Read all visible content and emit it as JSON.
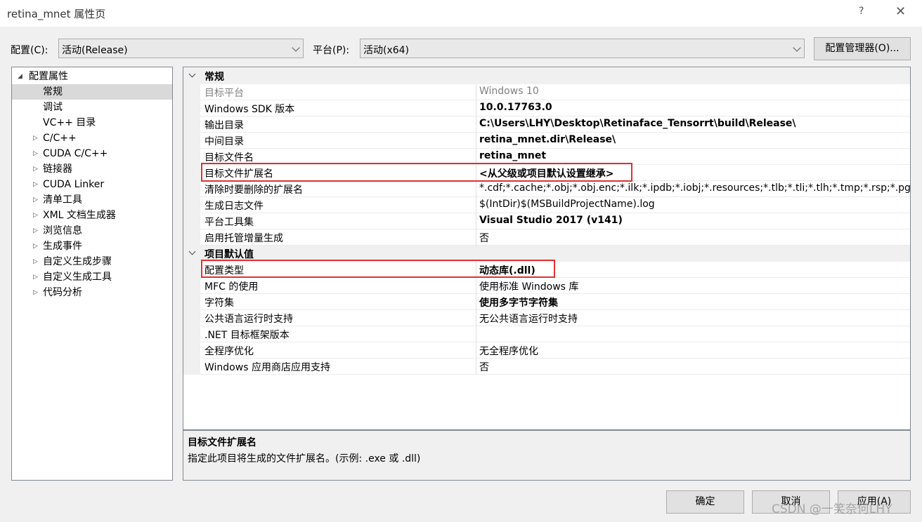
{
  "window": {
    "title": "retina_mnet 属性页",
    "help": "?",
    "close": "✕"
  },
  "top": {
    "config_label": "配置(C):",
    "config_value": "活动(Release)",
    "platform_label": "平台(P):",
    "platform_value": "活动(x64)",
    "config_manager": "配置管理器(O)..."
  },
  "tree": {
    "root": "配置属性",
    "items": [
      "常规",
      "调试",
      "VC++ 目录",
      "C/C++",
      "CUDA C/C++",
      "链接器",
      "CUDA Linker",
      "清单工具",
      "XML 文档生成器",
      "浏览信息",
      "生成事件",
      "自定义生成步骤",
      "自定义生成工具",
      "代码分析"
    ]
  },
  "grid": {
    "cat1": "常规",
    "cat2": "项目默认值",
    "rows1": [
      {
        "name": "目标平台",
        "value": "Windows 10"
      },
      {
        "name": "Windows SDK 版本",
        "value": "10.0.17763.0"
      },
      {
        "name": "输出目录",
        "value": "C:\\Users\\LHY\\Desktop\\Retinaface_Tensorrt\\build\\Release\\"
      },
      {
        "name": "中间目录",
        "value": "retina_mnet.dir\\Release\\"
      },
      {
        "name": "目标文件名",
        "value": "retina_mnet"
      },
      {
        "name": "目标文件扩展名",
        "value": "<从父级或项目默认设置继承>"
      },
      {
        "name": "清除时要删除的扩展名",
        "value": "*.cdf;*.cache;*.obj;*.obj.enc;*.ilk;*.ipdb;*.iobj;*.resources;*.tlb;*.tli;*.tlh;*.tmp;*.rsp;*.pgc;*.pgd;*.meta;*.tlog;*.manifest;*.res;*.pch"
      },
      {
        "name": "生成日志文件",
        "value": "$(IntDir)$(MSBuildProjectName).log"
      },
      {
        "name": "平台工具集",
        "value": "Visual Studio 2017 (v141)"
      },
      {
        "name": "启用托管增量生成",
        "value": "否"
      }
    ],
    "rows2": [
      {
        "name": "配置类型",
        "value": "动态库(.dll)"
      },
      {
        "name": "MFC 的使用",
        "value": "使用标准 Windows 库"
      },
      {
        "name": "字符集",
        "value": "使用多字节字符集"
      },
      {
        "name": "公共语言运行时支持",
        "value": "无公共语言运行时支持"
      },
      {
        "name": ".NET 目标框架版本",
        "value": ""
      },
      {
        "name": "全程序优化",
        "value": "无全程序优化"
      },
      {
        "name": "Windows 应用商店应用支持",
        "value": "否"
      }
    ]
  },
  "description": {
    "title": "目标文件扩展名",
    "text": "指定此项目将生成的文件扩展名。(示例: .exe 或 .dll)"
  },
  "buttons": {
    "ok": "确定",
    "cancel": "取消",
    "apply": "应用(A)"
  },
  "watermark": "CSDN @一笑奈何LHY",
  "colors": {
    "highlight_box": "#e03131",
    "selection": "#d9d9d9"
  }
}
